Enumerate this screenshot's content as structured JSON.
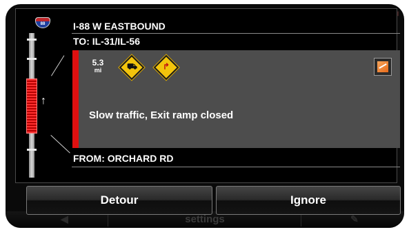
{
  "route": {
    "shield_text": "88",
    "title": "I-88 W EASTBOUND",
    "to_label": "TO: IL-31/IL-56",
    "from_label": "FROM: ORCHARD RD"
  },
  "alert": {
    "distance_value": "5.3",
    "distance_unit": "mi",
    "signs": [
      "slow-traffic-sign-icon",
      "exit-ramp-closed-sign-icon"
    ],
    "message": "Slow traffic, Exit ramp closed",
    "severity_color": "#e01010"
  },
  "actions": {
    "detour_label": "Detour",
    "ignore_label": "Ignore"
  },
  "background_footer": {
    "label": "settings"
  }
}
